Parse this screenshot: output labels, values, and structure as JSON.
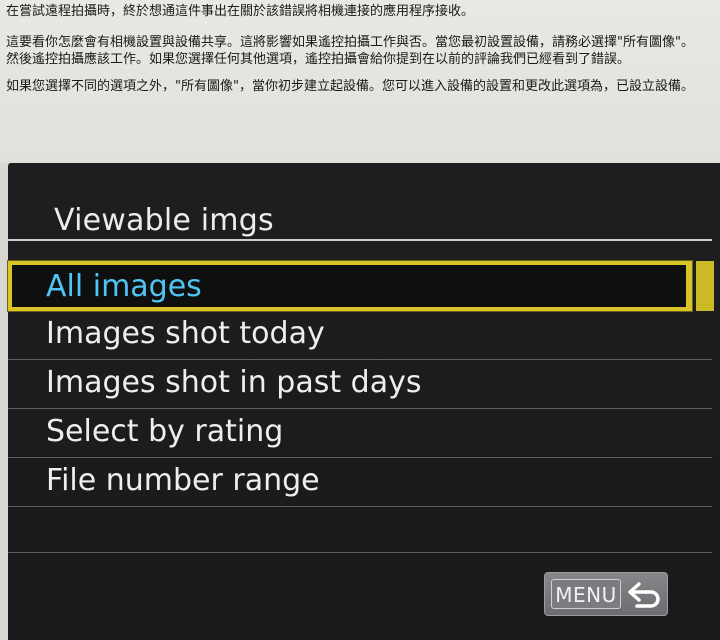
{
  "document": {
    "paragraphs": [
      "在嘗試遠程拍攝時，終於想通這件事出在關於該錯誤將相機連接的應用程序接收。",
      "這要看你怎麼會有相機設置與設備共享。這將影響如果遙控拍攝工作與否。當您最初設置設備，請務必選擇\"所有圖像\"。然後遙控拍攝應該工作。如果您選擇任何其他選項，遙控拍攝會給你提到在以前的評論我們已經看到了錯誤。",
      "如果您選擇不同的選項之外，\"所有圖像\"，當你初步建立起設備。您可以進入設備的設置和更改此選項為，已設立設備。"
    ]
  },
  "camera_screen": {
    "title": "Viewable imgs",
    "menu_items": [
      {
        "label": "All images",
        "selected": true
      },
      {
        "label": "Images shot today",
        "selected": false
      },
      {
        "label": "Images shot in past days",
        "selected": false
      },
      {
        "label": "Select by rating",
        "selected": false
      },
      {
        "label": "File number range",
        "selected": false
      }
    ],
    "menu_button": {
      "label": "MENU",
      "icon": "return-arrow-icon"
    }
  },
  "colors": {
    "selection_border": "#d8c427",
    "selected_text": "#4fc5f3",
    "screen_background": "#1b1c1e",
    "item_text": "#eeeeee"
  }
}
